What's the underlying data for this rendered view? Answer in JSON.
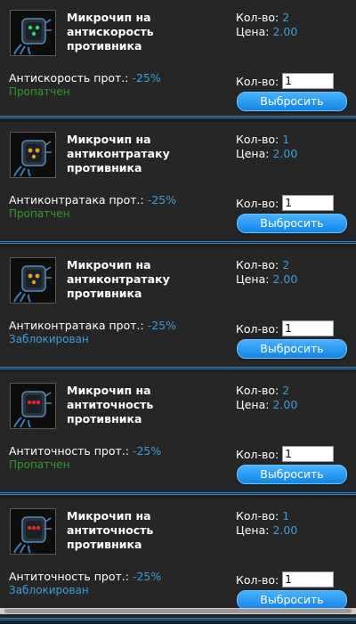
{
  "labels": {
    "qty": "Кол-во:",
    "price": "Цена:",
    "qty_input": "Кол-во:",
    "drop_button": "Выбросить"
  },
  "items": [
    {
      "title": "Микрочип на антискорость противника",
      "qty": "2",
      "price": "2.00",
      "stat_label": "Антискорость прот.:",
      "stat_value": "-25%",
      "state": "Пропатчен",
      "state_color": "#2e9b2e",
      "input_value": "1",
      "chip_light": "#2fe05a"
    },
    {
      "title": "Микрочип на антиконтратаку противника",
      "qty": "1",
      "price": "2.00",
      "stat_label": "Антиконтратака прот.:",
      "stat_value": "-25%",
      "state": "Пропатчен",
      "state_color": "#2e9b2e",
      "input_value": "1",
      "chip_light": "#e0a020"
    },
    {
      "title": "Микрочип на антиконтратаку противника",
      "qty": "2",
      "price": "2.00",
      "stat_label": "Антиконтратака прот.:",
      "stat_value": "-25%",
      "state": "Заблокирован",
      "state_color": "#3a9de0",
      "input_value": "1",
      "chip_light": "#e0a020"
    },
    {
      "title": "Микрочип на антиточность противника",
      "qty": "2",
      "price": "2.00",
      "stat_label": "Антиточность прот.:",
      "stat_value": "-25%",
      "state": "Пропатчен",
      "state_color": "#2e9b2e",
      "input_value": "1",
      "chip_light": "#e02828"
    },
    {
      "title": "Микрочип на антиточность противника",
      "qty": "1",
      "price": "2.00",
      "stat_label": "Антиточность прот.:",
      "stat_value": "-25%",
      "state": "Заблокирован",
      "state_color": "#3a9de0",
      "input_value": "1",
      "chip_light": "#e02828"
    }
  ]
}
